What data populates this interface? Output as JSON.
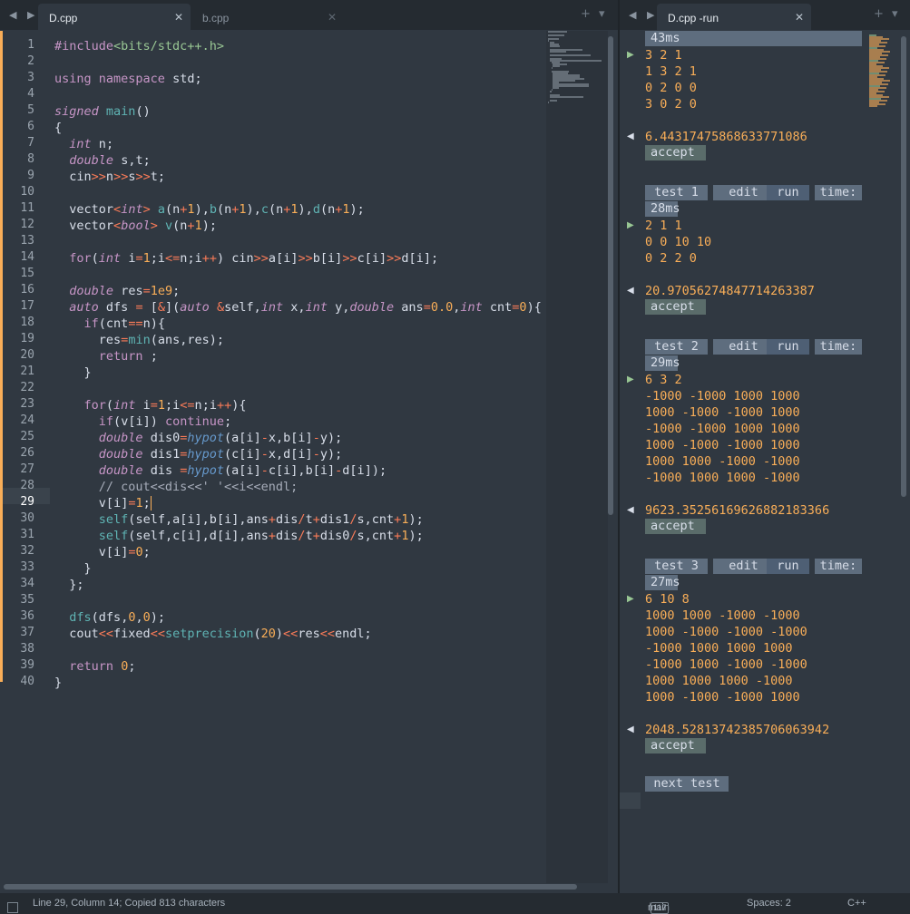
{
  "colors": {
    "bg": "#303841",
    "accent": "#f9ae58",
    "keyword": "#c695c6",
    "function": "#5fb4b4",
    "number": "#f9ae58",
    "operator": "#f97b58"
  },
  "left_pane": {
    "tabs": [
      {
        "label": "D.cpp",
        "active": true
      },
      {
        "label": "b.cpp",
        "active": false
      }
    ],
    "nav_arrows": "◀ ▶",
    "new_tab": "+",
    "tab_menu": "▾",
    "close_glyph": "✕"
  },
  "right_pane": {
    "tabs": [
      {
        "label": "D.cpp -run",
        "active": true
      }
    ],
    "nav_arrows": "◀ ▶",
    "new_tab": "+",
    "tab_menu": "▾",
    "close_glyph": "✕"
  },
  "editor": {
    "current_line": 29,
    "line_numbers": [
      "1",
      "2",
      "3",
      "4",
      "5",
      "6",
      "7",
      "8",
      "9",
      "10",
      "11",
      "12",
      "13",
      "14",
      "15",
      "16",
      "17",
      "18",
      "19",
      "20",
      "21",
      "22",
      "23",
      "24",
      "25",
      "26",
      "27",
      "28",
      "29",
      "30",
      "31",
      "32",
      "33",
      "34",
      "35",
      "36",
      "37",
      "38",
      "39",
      "40"
    ],
    "lines": [
      "#include<bits/stdc++.h>",
      "",
      "using namespace std;",
      "",
      "signed main()",
      "{",
      "  int n;",
      "  double s,t;",
      "  cin>>n>>s>>t;",
      "",
      "  vector<int> a(n+1),b(n+1),c(n+1),d(n+1);",
      "  vector<bool> v(n+1);",
      "",
      "  for(int i=1;i<=n;i++) cin>>a[i]>>b[i]>>c[i]>>d[i];",
      "",
      "  double res=1e9;",
      "  auto dfs = [&](auto &self,int x,int y,double ans=0.0,int cnt=0){",
      "    if(cnt==n){",
      "      res=min(ans,res);",
      "      return ;",
      "    }",
      "",
      "    for(int i=1;i<=n;i++){",
      "      if(v[i]) continue;",
      "      double dis0=hypot(a[i]-x,b[i]-y);",
      "      double dis1=hypot(c[i]-x,d[i]-y);",
      "      double dis =hypot(a[i]-c[i],b[i]-d[i]);",
      "      // cout<<dis<<' '<<i<<endl;",
      "      v[i]=1;",
      "      self(self,a[i],b[i],ans+dis/t+dis1/s,cnt+1);",
      "      self(self,c[i],d[i],ans+dis/t+dis0/s,cnt+1);",
      "      v[i]=0;",
      "    }",
      "  };",
      "",
      "  dfs(dfs,0,0);",
      "  cout<<fixed<<setprecision(20)<<res<<endl;",
      "",
      "  return 0;",
      "}"
    ]
  },
  "output": {
    "first_time": "43ms",
    "tests": [
      {
        "input": [
          "3 2 1",
          "1 3 2 1",
          "0 2 0 0",
          "3 0 2 0"
        ],
        "result": "6.44317475868633771086",
        "verdict": "accept"
      },
      {
        "label": "test 1",
        "edit": "edit",
        "run": "run",
        "time_label": "time:",
        "time": "28ms",
        "input": [
          "2 1 1",
          "0 0 10 10",
          "0 2 2 0"
        ],
        "result": "20.97056274847714263387",
        "verdict": "accept"
      },
      {
        "label": "test 2",
        "edit": "edit",
        "run": "run",
        "time_label": "time:",
        "time": "29ms",
        "input": [
          "6 3 2",
          "-1000 -1000 1000 1000",
          "1000 -1000 -1000 1000",
          "-1000 -1000 1000 1000",
          "1000 -1000 -1000 1000",
          "1000 1000 -1000 -1000",
          "-1000 1000 1000 -1000"
        ],
        "result": "9623.35256169626882183366",
        "verdict": "accept"
      },
      {
        "label": "test 3",
        "edit": "edit",
        "run": "run",
        "time_label": "time:",
        "time": "27ms",
        "input": [
          "6 10 8",
          "1000 1000 -1000 -1000",
          "1000 -1000 -1000 -1000",
          "-1000 1000 1000 1000",
          "-1000 1000 -1000 -1000",
          "1000 1000 1000 -1000",
          "1000 -1000 -1000 1000"
        ],
        "result": "2048.52813742385706063942",
        "verdict": "accept"
      }
    ],
    "next_test": "next test"
  },
  "statusbar": {
    "position": "Line 29, Column 14; Copied 813 characters",
    "branch": "main",
    "branch_count": "117",
    "spaces": "Spaces: 2",
    "syntax": "C++"
  }
}
